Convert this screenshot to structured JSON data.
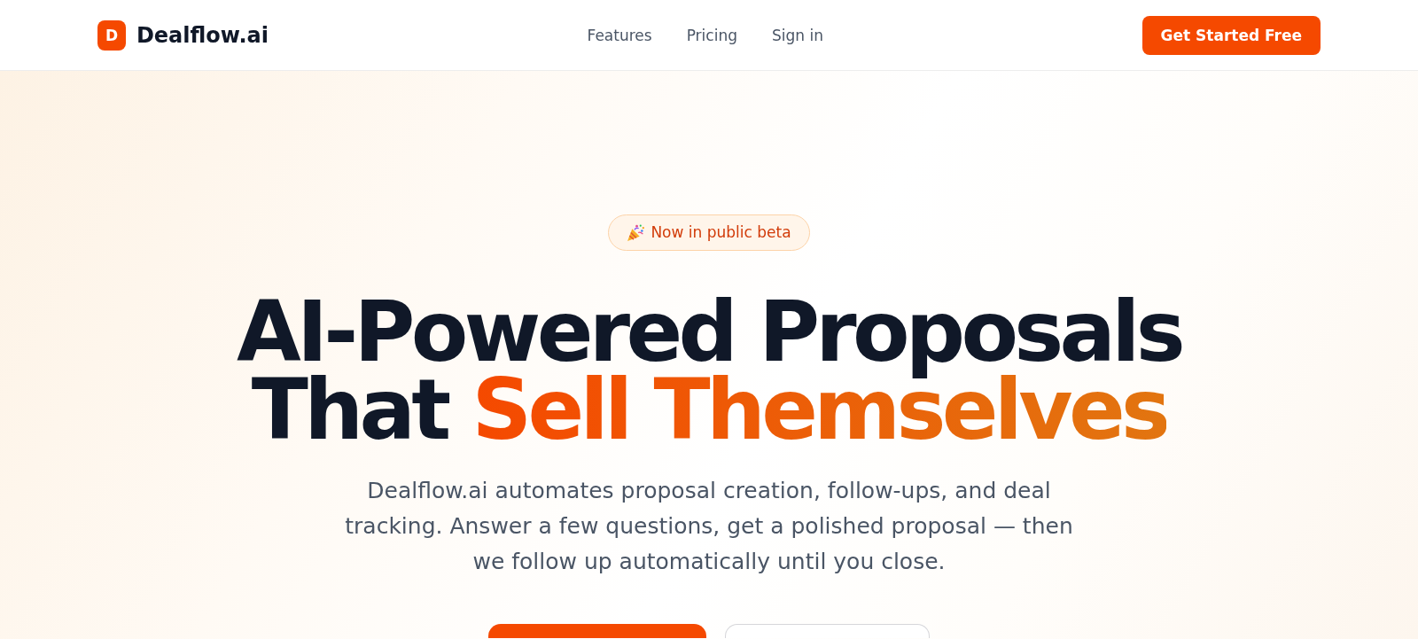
{
  "header": {
    "logo": {
      "letter": "D",
      "name": "Dealflow.ai"
    },
    "nav": [
      {
        "label": "Features"
      },
      {
        "label": "Pricing"
      },
      {
        "label": "Sign in"
      }
    ],
    "cta": "Get Started Free"
  },
  "hero": {
    "badge": "Now in public beta",
    "headline": {
      "lead": "AI-Powered Proposals That",
      "highlight": "Sell Themselves"
    },
    "subtitle": "Dealflow.ai automates proposal creation, follow-ups, and deal tracking. Answer a few questions, get a polished proposal — then we follow up automatically until you close.",
    "buttons": [
      {
        "kind": "primary"
      },
      {
        "kind": "outline"
      }
    ]
  }
}
